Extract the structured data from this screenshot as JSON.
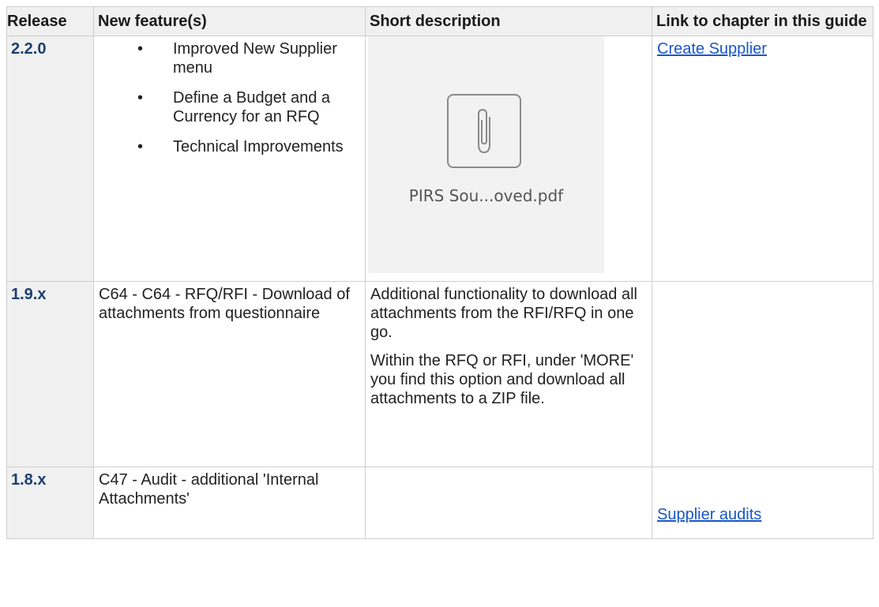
{
  "headers": {
    "release": "Release",
    "features": "New feature(s)",
    "description": "Short description",
    "link": "Link to chapter in this guide"
  },
  "rows": [
    {
      "release": "2.2.0",
      "features": [
        "Improved New Supplier menu",
        "Define a Budget and a Currency for an RFQ",
        "Technical Improvements"
      ],
      "attachment": {
        "filename": "PIRS Sou...oved.pdf",
        "icon": "paperclip-icon"
      },
      "link": "Create Supplier"
    },
    {
      "release": "1.9.x",
      "feature": "C64 - C64 - RFQ/RFI - Download of attachments from questionnaire",
      "description": [
        "Additional functionality to download all attachments from the RFI/RFQ in one go.",
        "Within the RFQ or RFI, under 'MORE' you find this option and download all attachments to a ZIP file."
      ],
      "link": ""
    },
    {
      "release": "1.8.x",
      "feature": "C47 - Audit - additional 'Internal Attachments'",
      "description": "",
      "link": "Supplier audits"
    }
  ],
  "colors": {
    "release_text": "#1c3f6e",
    "link": "#1a56c8",
    "header_bg": "#f0f0f0"
  }
}
